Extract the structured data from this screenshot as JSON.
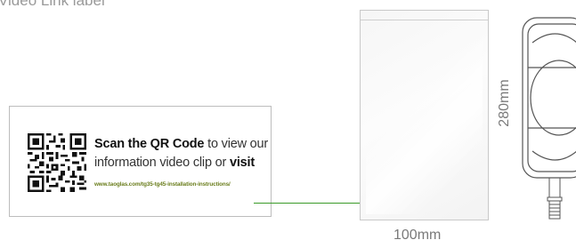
{
  "top_label": "Video Link label",
  "label_card": {
    "line1_bold": "Scan the QR Code",
    "line1_rest": " to view our",
    "line2_rest": "information video clip or ",
    "line2_bold": "visit",
    "url": "www.taoglas.com/tg35-tg45-installation-instructions/"
  },
  "dimensions": {
    "height": "280mm",
    "width": "100mm"
  },
  "colors": {
    "connector": "#3a9a28",
    "url_text": "#6a7d1c"
  },
  "icons": {
    "qr": "qr-code-icon",
    "device": "antenna-device-icon"
  }
}
